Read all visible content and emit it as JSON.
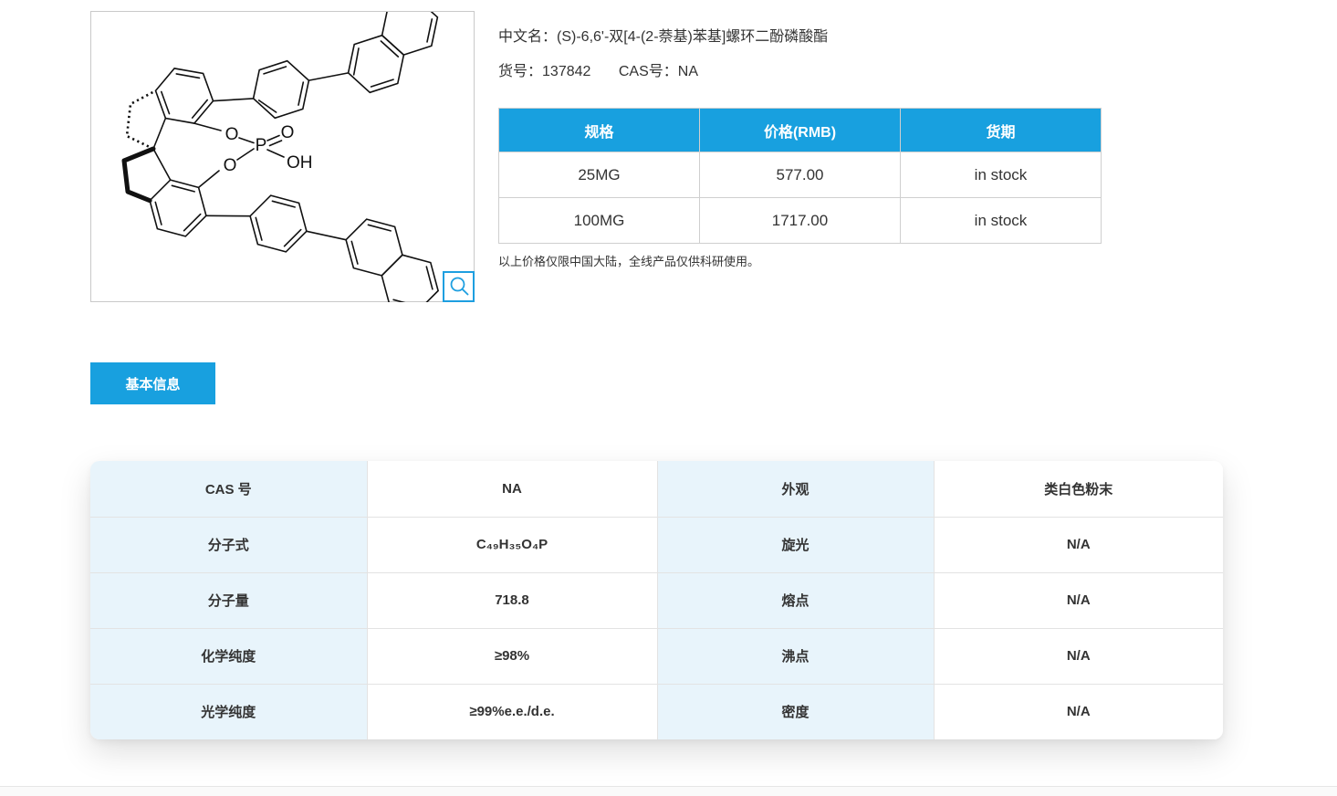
{
  "product": {
    "name_label": "中文名：",
    "name": "(S)-6,6'-双[4-(2-萘基)苯基]螺环二酚磷酸酯",
    "sku_label": "货号：",
    "sku": "137842",
    "cas_label": "CAS号：",
    "cas": "NA"
  },
  "structure": {
    "atoms": {
      "o_upper": "O",
      "o_lower": "O",
      "p": "P",
      "o_double": "O",
      "oh": "OH"
    }
  },
  "price_table": {
    "headers": [
      "规格",
      "价格(RMB)",
      "货期"
    ],
    "rows": [
      {
        "spec": "25MG",
        "price": "577.00",
        "stock": "in stock"
      },
      {
        "spec": "100MG",
        "price": "1717.00",
        "stock": "in stock"
      }
    ],
    "note": "以上价格仅限中国大陆，全线产品仅供科研使用。"
  },
  "tabs": {
    "basic_info": "基本信息"
  },
  "basic_table": {
    "rows": [
      {
        "label1": "CAS 号",
        "value1": "NA",
        "label2": "外观",
        "value2": "类白色粉末"
      },
      {
        "label1": "分子式",
        "value1": "C₄₉H₃₅O₄P",
        "label2": "旋光",
        "value2": "N/A"
      },
      {
        "label1": "分子量",
        "value1": "718.8",
        "label2": "熔点",
        "value2": "N/A"
      },
      {
        "label1": "化学纯度",
        "value1": "≥98%",
        "label2": "沸点",
        "value2": "N/A"
      },
      {
        "label1": "光学纯度",
        "value1": "≥99%e.e./d.e.",
        "label2": "密度",
        "value2": "N/A"
      }
    ]
  },
  "colors": {
    "accent": "#18A0DF",
    "label_cell_bg": "#E8F4FB",
    "table_border": "#CFCFCF"
  }
}
